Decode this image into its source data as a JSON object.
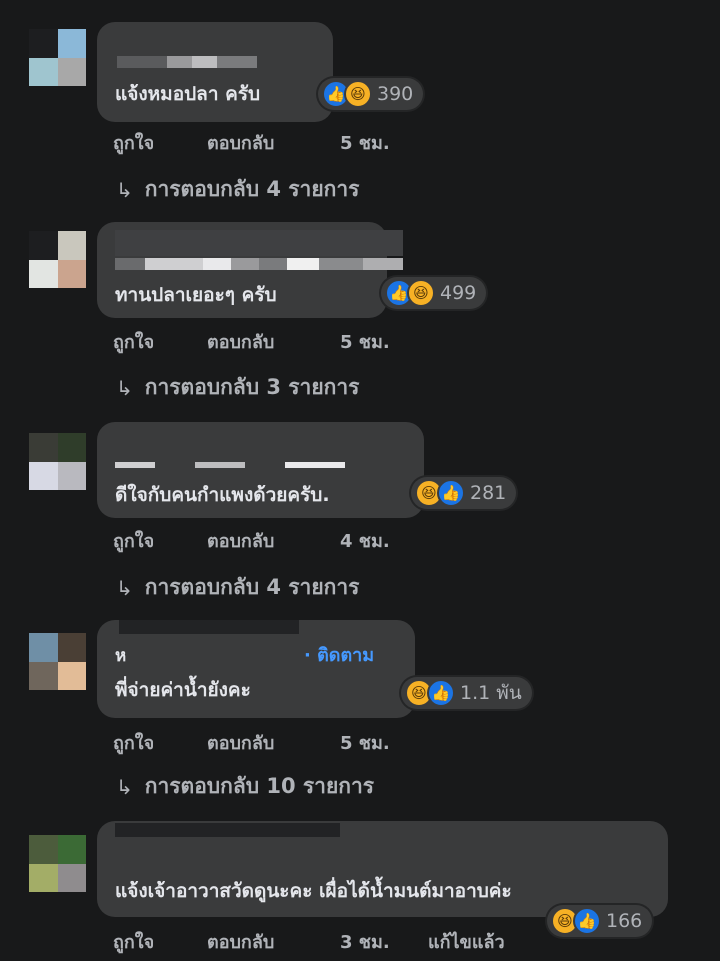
{
  "comments": [
    {
      "text": "แจ้งหมอปลา ครับ",
      "reaction_count": "390",
      "reaction_icons": [
        "like-icon",
        "haha-icon"
      ],
      "actions": {
        "like": "ถูกใจ",
        "reply": "ตอบกลับ",
        "time": "5 ชม."
      },
      "replies": "การตอบกลับ 4 รายการ"
    },
    {
      "text": "ทานปลาเยอะๆ ครับ",
      "reaction_count": "499",
      "reaction_icons": [
        "like-icon",
        "haha-icon"
      ],
      "actions": {
        "like": "ถูกใจ",
        "reply": "ตอบกลับ",
        "time": "5 ชม."
      },
      "replies": "การตอบกลับ 3 รายการ"
    },
    {
      "text": "ดีใจกับคนกำแพงด้วยครับ.",
      "reaction_count": "281",
      "reaction_icons": [
        "haha-icon",
        "like-icon"
      ],
      "actions": {
        "like": "ถูกใจ",
        "reply": "ตอบกลับ",
        "time": "4 ชม."
      },
      "replies": "การตอบกลับ 4 รายการ"
    },
    {
      "name_initial": "ห",
      "follow": "· ติดตาม",
      "text": "พี่จ่ายค่าน้ำยังคะ",
      "reaction_count": "1.1 พัน",
      "reaction_icons": [
        "haha-icon",
        "like-icon"
      ],
      "actions": {
        "like": "ถูกใจ",
        "reply": "ตอบกลับ",
        "time": "5 ชม."
      },
      "replies": "การตอบกลับ 10 รายการ"
    },
    {
      "text": "แจ้งเจ้าอาวาสวัดดูนะคะ เผื่อได้น้ำมนต์มาอาบค่ะ",
      "reaction_count": "166",
      "reaction_icons": [
        "haha-icon",
        "like-icon"
      ],
      "actions": {
        "like": "ถูกใจ",
        "reply": "ตอบกลับ",
        "time": "3 ชม.",
        "edited": "แก้ไขแล้ว"
      }
    }
  ],
  "colors": {
    "background": "#18191a",
    "bubble": "#3a3b3c",
    "link_blue": "#4599ff",
    "like_blue": "#1b74e4",
    "haha_yellow": "#f7b125",
    "secondary_text": "#b0b3b8"
  }
}
